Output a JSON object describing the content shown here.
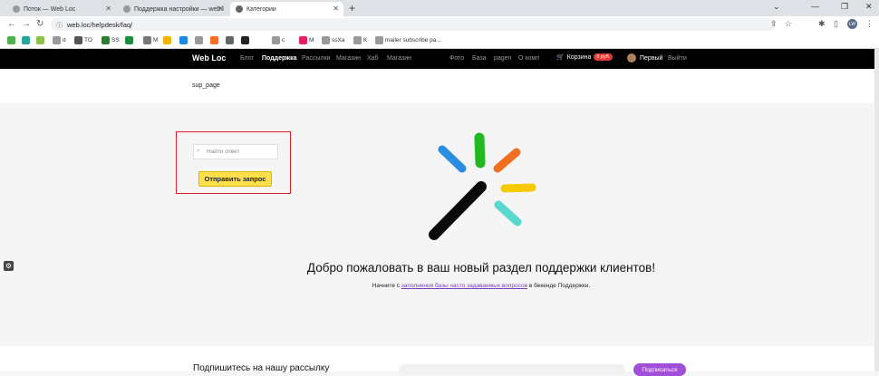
{
  "browser": {
    "tabs": [
      {
        "label": "Поток — Web Loc"
      },
      {
        "label": "Поддержка настройки — web.l"
      },
      {
        "label": "Категории"
      }
    ],
    "url": "web.loc/helpdesk/faq/",
    "profile_initials": "LW",
    "bookmarks": [
      "",
      "",
      "",
      "d",
      "TO",
      "SS",
      "",
      "M",
      "",
      "",
      "",
      "",
      "",
      "",
      "c",
      "M",
      "ssXa",
      "K",
      "mailer subscribe pa..."
    ]
  },
  "site": {
    "logo": "Web Loc",
    "nav": [
      "Блог",
      "Поддержка",
      "Рассылки",
      "Магазин",
      "Хаб",
      "Магазин",
      "Фото",
      "База",
      "pagen",
      "О комп"
    ],
    "active_nav_index": 1,
    "cart_label": "Корзина",
    "cart_badge": "0 руб.",
    "user_name": "Первый",
    "logout_label": "Выйти",
    "breadcrumb": "sup_page"
  },
  "search": {
    "placeholder": "Найти ответ",
    "button_label": "Отправить запрос"
  },
  "hero": {
    "title": "Добро пожаловать в ваш новый раздел поддержки клиентов!",
    "text_before": "Начните с ",
    "link_text": "заполнения базы часто задаваемых вопросов",
    "text_after": " в бекенде Поддержки.",
    "colors": {
      "green": "#22b822",
      "orange": "#f07020",
      "blue": "#2a8de0",
      "yellow": "#f8c800",
      "cyan": "#5ad8d0",
      "black": "#0a0a0a"
    }
  },
  "footer": {
    "title": "Подпишитесь на нашу рассылку",
    "button_label": "Подписаться"
  }
}
